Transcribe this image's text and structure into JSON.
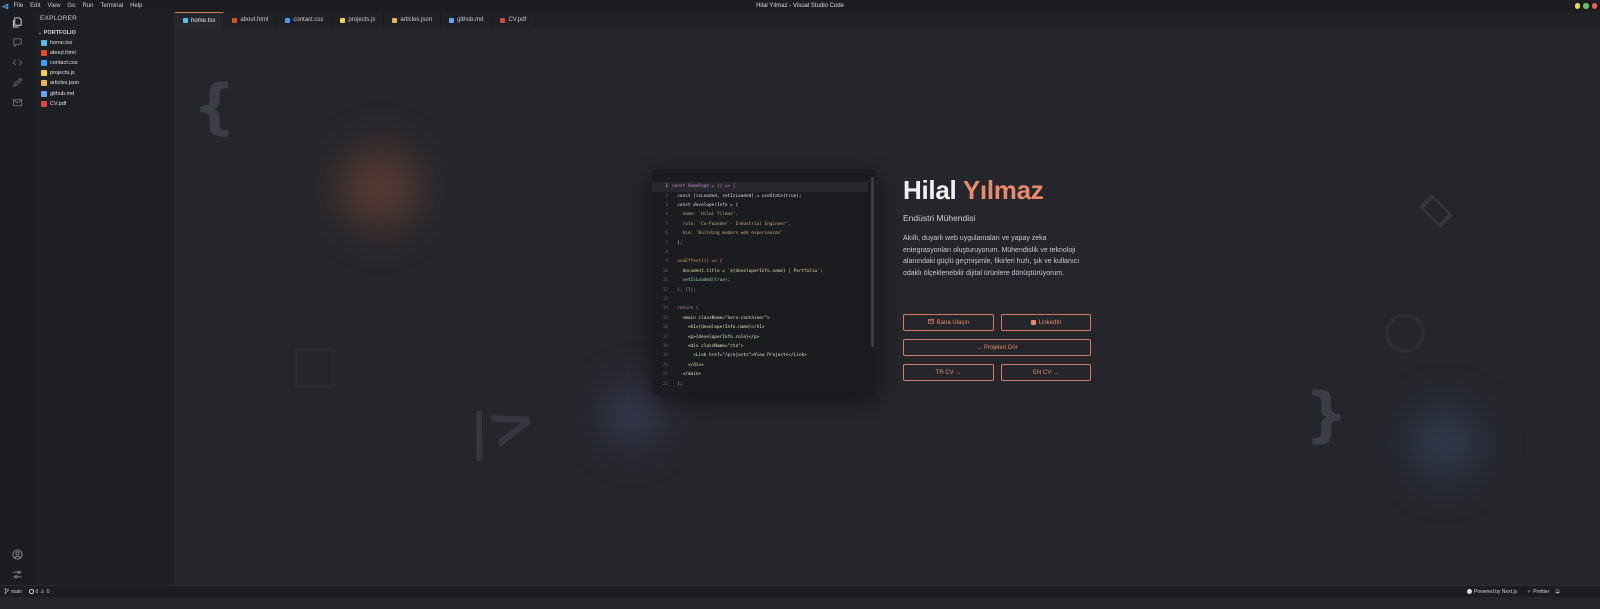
{
  "window": {
    "title": "Hilal Yılmaz - Visual Studio Code",
    "menu": [
      "File",
      "Edit",
      "View",
      "Go",
      "Run",
      "Terminal",
      "Help"
    ],
    "controls": [
      "#f4d35e",
      "#67c16b",
      "#ef5b5b"
    ]
  },
  "sidebar": {
    "title": "EXPLORER",
    "folder": "PORTFOLIO",
    "files": [
      {
        "name": "home.tsx",
        "icon": "react-icon",
        "color": "#4fc1e9"
      },
      {
        "name": "about.html",
        "icon": "html-icon",
        "color": "#e44d26"
      },
      {
        "name": "contact.css",
        "icon": "css-icon",
        "color": "#3b9cff"
      },
      {
        "name": "projects.js",
        "icon": "js-icon",
        "color": "#f0d43a"
      },
      {
        "name": "articles.json",
        "icon": "json-icon",
        "color": "#e8b54d"
      },
      {
        "name": "github.md",
        "icon": "markdown-icon",
        "color": "#6ca0ff"
      },
      {
        "name": "CV.pdf",
        "icon": "pdf-icon",
        "color": "#e0443a"
      }
    ]
  },
  "tabs": [
    {
      "label": "home.tsx",
      "color": "#4fc1e9"
    },
    {
      "label": "about.html",
      "color": "#e44d26"
    },
    {
      "label": "contact.css",
      "color": "#3b9cff"
    },
    {
      "label": "projects.js",
      "color": "#f0d43a"
    },
    {
      "label": "articles.json",
      "color": "#e8b54d"
    },
    {
      "label": "github.md",
      "color": "#6ca0ff"
    },
    {
      "label": "CV.pdf",
      "color": "#e0443a"
    }
  ],
  "code": [
    {
      "n": "1",
      "t": "const HomePage = () => {",
      "c": "#c586c0"
    },
    {
      "n": "2",
      "t": "  const [isLoaded, setIsLoaded] = useState(true);",
      "c": "#d7dbe0"
    },
    {
      "n": "3",
      "t": "  const developerInfo = {",
      "c": "#d7dbe0"
    },
    {
      "n": "4",
      "t": "    name: 'Hilal Yılmaz',",
      "c": "#c9a77a"
    },
    {
      "n": "5",
      "t": "    role: 'Co-Founder - Industrial Engineer',",
      "c": "#c9a77a"
    },
    {
      "n": "6",
      "t": "    bio: 'Building modern web experiences'",
      "c": "#c9a77a"
    },
    {
      "n": "7",
      "t": "  };",
      "c": "#d7dbe0"
    },
    {
      "n": "8",
      "t": "",
      "c": "#d7dbe0"
    },
    {
      "n": "9",
      "t": "  useEffect(() => {",
      "c": "#d0a062"
    },
    {
      "n": "10",
      "t": "    document.title = `${developerInfo.name} | Portfolio`;",
      "c": "#e5d69a"
    },
    {
      "n": "11",
      "t": "    setIsLoaded(true);",
      "c": "#8fd6a9"
    },
    {
      "n": "12",
      "t": "  }, []);",
      "c": "#9aa0a8"
    },
    {
      "n": "13",
      "t": "",
      "c": "#d7dbe0"
    },
    {
      "n": "14",
      "t": "  return (",
      "c": "#c586c0"
    },
    {
      "n": "15",
      "t": "    <main className=\"hero-container\">",
      "c": "#e6dcc0"
    },
    {
      "n": "16",
      "t": "      <h1>{developerInfo.name}</h1>",
      "c": "#e6dcc0"
    },
    {
      "n": "17",
      "t": "      <p>{developerInfo.role}</p>",
      "c": "#e6dcc0"
    },
    {
      "n": "18",
      "t": "      <div className=\"cta\">",
      "c": "#e6dcc0"
    },
    {
      "n": "19",
      "t": "        <Link href=\"/projects\">View Projects</Link>",
      "c": "#e6dcc0"
    },
    {
      "n": "20",
      "t": "      </div>",
      "c": "#e6dcc0"
    },
    {
      "n": "21",
      "t": "    </main>",
      "c": "#e6dcc0"
    },
    {
      "n": "22",
      "t": "  );",
      "c": "#d7dbe0"
    }
  ],
  "hero": {
    "first_name": "Hilal",
    "last_name": "Yılmaz",
    "role": "Endüstri Mühendisi",
    "bio": "Akıllı, duyarlı web uygulamaları ve yapay zeka entegrasyonları oluşturuyorum. Mühendislik ve teknoloji alanındaki güçlü geçmişimle, fikirleri hızlı, şık ve kullanıcı odaklı ölçeklenebilir dijital ürünlere dönüştürüyorum.",
    "buttons": {
      "contact": "Bana Ulaşın",
      "linkedin": "LinkedIn",
      "projects": "→ Projeleri Gör",
      "tr_cv": "TR CV →",
      "en_cv": "EN CV →"
    },
    "accent": "#e8896c"
  },
  "statusbar": {
    "branch": "main",
    "errors": "0",
    "warnings": "0",
    "powered": "Powered by Next.js",
    "prettier": "Prettier"
  }
}
